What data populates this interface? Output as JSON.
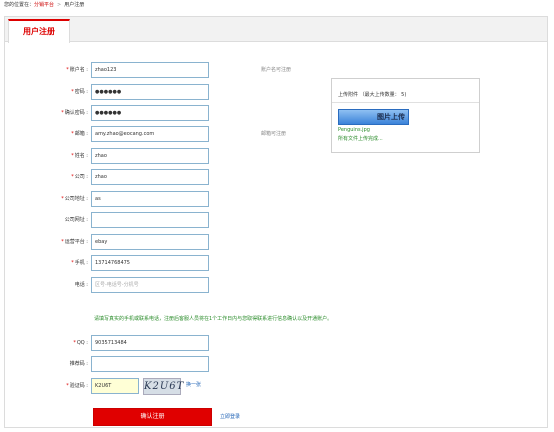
{
  "breadcrumb": {
    "prefix": "您的位置在：",
    "link": "分销平台",
    "sep": ">",
    "current": "用户注册"
  },
  "tab": {
    "label": "用户注册"
  },
  "form": {
    "account": {
      "label": "账户名",
      "value": "zhao123",
      "hint": "账户名可注册"
    },
    "password": {
      "label": "密码",
      "value": "●●●●●●"
    },
    "confirm_password": {
      "label": "确认密码",
      "value": "●●●●●●"
    },
    "email": {
      "label": "邮箱",
      "value": "amy.zhao@eocang.com",
      "hint": "邮箱可注册"
    },
    "name": {
      "label": "姓名",
      "value": "zhao"
    },
    "company": {
      "label": "公司",
      "value": "zhao"
    },
    "company_address": {
      "label": "公司地址",
      "value": "as"
    },
    "company_website": {
      "label": "公司网址",
      "value": ""
    },
    "platform": {
      "label": "运营平台",
      "value": "ebay"
    },
    "mobile": {
      "label": "手机",
      "value": "13714768475"
    },
    "phone": {
      "label": "电话",
      "placeholder": "区号-电话号-分机号"
    },
    "note": "请填写真实的手机或联系电话，注册后客服人员将在1个工作日内与您取得联系进行信息确认以及开通账户。",
    "qq": {
      "label": "QQ",
      "value": "9035713484"
    },
    "referrer": {
      "label": "推荐码",
      "value": ""
    },
    "captcha": {
      "label": "验证码",
      "value": "K2U6T",
      "image_text": "K2U6T",
      "refresh": "换一张"
    },
    "submit": "确认注册",
    "login_link": "立即登录"
  },
  "upload": {
    "title": "上传附件 （最大上传数量： 5)",
    "button": "图片上传",
    "file": "Penguins.jpg",
    "status": "所有文件上传完成..."
  },
  "colors": {
    "accent": "#e00000",
    "link": "#1a5fb4",
    "success": "#2a8c2a"
  }
}
